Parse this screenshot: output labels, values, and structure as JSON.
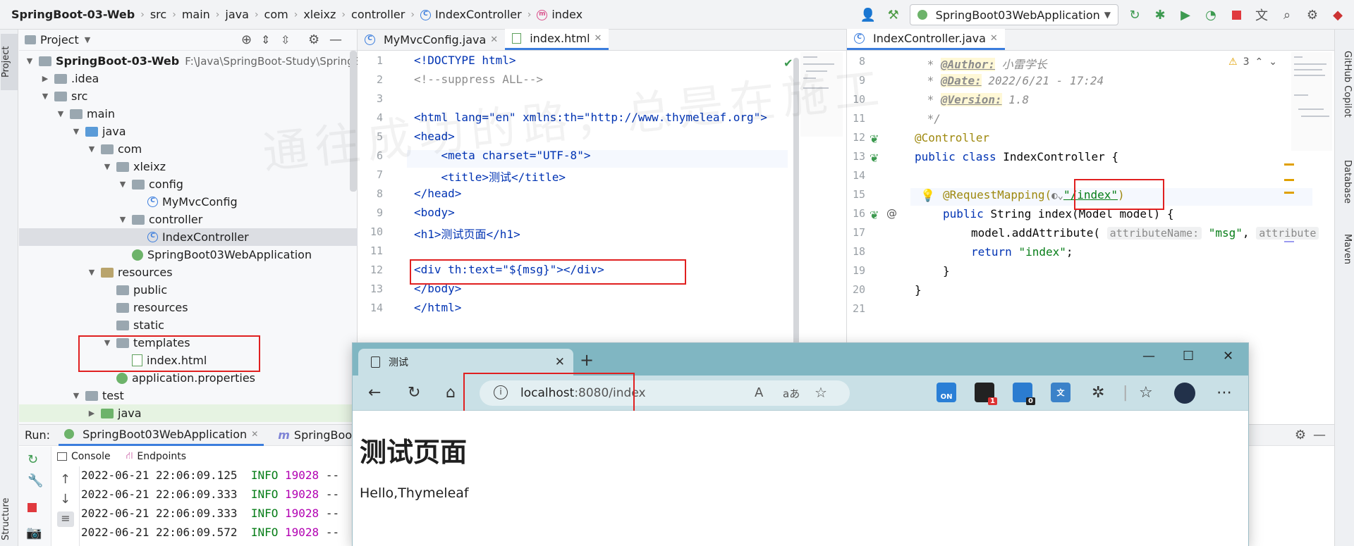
{
  "breadcrumbs": [
    "SpringBoot-03-Web",
    "src",
    "main",
    "java",
    "com",
    "xleixz",
    "controller",
    "IndexController",
    "index"
  ],
  "toolbar": {
    "run_config": "SpringBoot03WebApplication"
  },
  "left_strip": {
    "project_tab": "Project",
    "structure_tab": "Structure"
  },
  "right_strip": {
    "tabs": [
      "GitHub Copilot",
      "Database",
      "Maven"
    ]
  },
  "project": {
    "title": "Project",
    "root_name": "SpringBoot-03-Web",
    "root_path": "F:\\Java\\SpringBoot-Study\\SpringBoot-03-Web",
    "items": [
      ".idea",
      "src",
      "main",
      "java",
      "com",
      "xleixz",
      "config",
      "MyMvcConfig",
      "controller",
      "IndexController",
      "SpringBoot03WebApplication",
      "resources",
      "public",
      "resources",
      "static",
      "templates",
      "index.html",
      "application.properties",
      "test",
      "java"
    ]
  },
  "editor1": {
    "tabs": [
      "MyMvcConfig.java",
      "index.html"
    ],
    "line_numbers": [
      "1",
      "2",
      "3",
      "4",
      "5",
      "6",
      "7",
      "8",
      "9",
      "10",
      "11",
      "12",
      "13",
      "14"
    ],
    "lines": [
      "<!DOCTYPE html>",
      "<!--suppress ALL-->",
      "",
      "<html lang=\"en\" xmlns:th=\"http://www.thymeleaf.org\">",
      "<head>",
      "    <meta charset=\"UTF-8\">",
      "    <title>测试</title>",
      "</head>",
      "<body>",
      "<h1>测试页面</h1>",
      "",
      "<div th:text=\"${msg}\"></div>",
      "</body>",
      "</html>"
    ]
  },
  "editor2": {
    "tab": "IndexController.java",
    "warnings": "3",
    "line_numbers": [
      "8",
      "9",
      "10",
      "11",
      "12",
      "13",
      "14",
      "15",
      "16",
      "17",
      "18",
      "19",
      "20",
      "21"
    ],
    "doc_author_tag": "@Author:",
    "doc_author_val": " 小雷学长",
    "doc_date_tag": "@Date:",
    "doc_date_val": " 2022/6/21 - 17:24",
    "doc_version_tag": "@Version:",
    "doc_version_val": " 1.8",
    "doc_end": " */",
    "ann_controller": "@Controller",
    "class_decl_kw": "public class ",
    "class_name": "IndexController {",
    "ann_mapping": "@RequestMapping(",
    "mapping_value": "\"/index\"",
    "mapping_close": ")",
    "method_kw": "public ",
    "method_rest": "String index(Model model) {",
    "call_start": "model.addAttribute(",
    "hint_name": "attributeName:",
    "call_msg": "\"msg\"",
    "hint_value": "attribute",
    "return_kw": "return ",
    "return_val": "\"index\"",
    "return_end": ";",
    "close_method": "}",
    "close_class": "}"
  },
  "run": {
    "label": "Run:",
    "tabs": [
      "SpringBoot03WebApplication",
      "SpringBoot-"
    ],
    "subtabs": [
      "Console",
      "Endpoints"
    ],
    "logs": [
      {
        "time": "2022-06-21 22:06:09.125",
        "level": "INFO",
        "pid": "19028",
        "sep": "--"
      },
      {
        "time": "2022-06-21 22:06:09.333",
        "level": "INFO",
        "pid": "19028",
        "sep": "--"
      },
      {
        "time": "2022-06-21 22:06:09.333",
        "level": "INFO",
        "pid": "19028",
        "sep": "--"
      },
      {
        "time": "2022-06-21 22:06:09.572",
        "level": "INFO",
        "pid": "19028",
        "sep": "--"
      }
    ]
  },
  "browser": {
    "tab_title": "测试",
    "url_host": "localhost",
    "url_rest": ":8080/index",
    "read_aloud": "A",
    "translate": "aあ",
    "ext_on": "ON",
    "badge1": "1",
    "badge2": "0",
    "page_h1": "测试页面",
    "page_div": "Hello,Thymeleaf"
  },
  "watermark": "通往成功的路，总是在施工"
}
